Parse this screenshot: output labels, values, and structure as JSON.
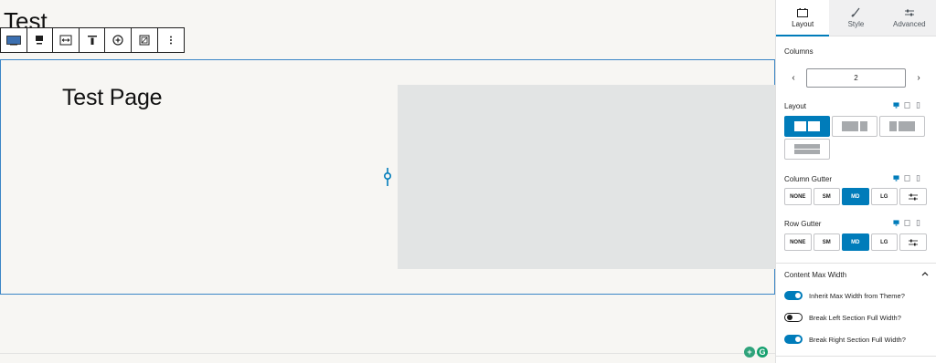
{
  "canvas": {
    "page_title": "Test",
    "section_heading": "Test Page",
    "toolbar_icons": [
      "section-block-icon",
      "align-top-icon",
      "full-width-icon",
      "vertical-align-top-icon",
      "add-icon",
      "resize-icon",
      "more-options-icon"
    ]
  },
  "sidebar": {
    "tabs": [
      {
        "label": "Layout",
        "icon": "layout-icon"
      },
      {
        "label": "Style",
        "icon": "brush-icon"
      },
      {
        "label": "Advanced",
        "icon": "sliders-icon"
      }
    ],
    "columns": {
      "label": "Columns",
      "value": "2",
      "prev": "‹",
      "next": "›"
    },
    "layout": {
      "label": "Layout",
      "selected": "two-equal"
    },
    "column_gutter": {
      "label": "Column Gutter",
      "options": [
        "NONE",
        "SM",
        "MD",
        "LG"
      ],
      "selected": "MD"
    },
    "row_gutter": {
      "label": "Row Gutter",
      "options": [
        "NONE",
        "SM",
        "MD",
        "LG"
      ],
      "selected": "MD"
    },
    "content_max_width": {
      "label": "Content Max Width",
      "toggles": [
        {
          "label": "Inherit Max Width from Theme?",
          "on": true
        },
        {
          "label": "Break Left Section Full Width?",
          "on": false
        },
        {
          "label": "Break Right Section Full Width?",
          "on": true
        }
      ]
    }
  },
  "colors": {
    "accent": "#007cba",
    "border": "#3b86c6",
    "placeholder": "#e2e4e4"
  }
}
